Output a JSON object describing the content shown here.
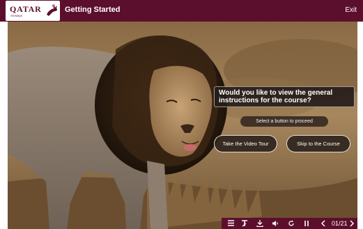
{
  "header": {
    "logo_text": "QATAR",
    "logo_subtext": "Airways",
    "title": "Getting Started",
    "exit_label": "Exit"
  },
  "overlay": {
    "question": "Would you like to view the general instructions for the course?",
    "hint": "Select a button to proceed",
    "buttons": [
      {
        "label": "Take the Video Tour"
      },
      {
        "label": "Skip to the Course"
      }
    ]
  },
  "controls": {
    "icons": [
      "menu-icon",
      "text-size-icon",
      "download-icon",
      "volume-icon",
      "replay-icon",
      "pause-icon",
      "previous-icon",
      "next-icon"
    ],
    "page_indicator": "01/21"
  },
  "colors": {
    "brand": "#5c0f2c"
  }
}
